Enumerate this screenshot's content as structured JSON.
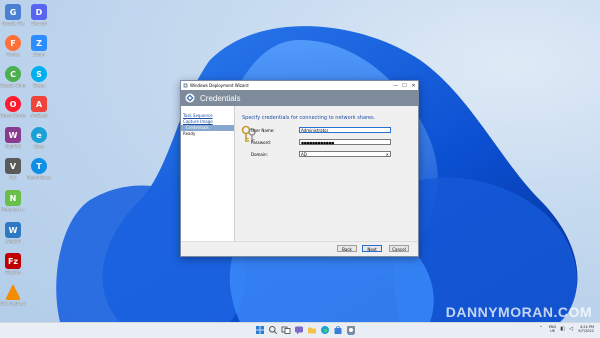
{
  "desktop": {
    "icons": [
      {
        "label": "Google File",
        "icon": "google-file-icon",
        "color": "#4a7fd4"
      },
      {
        "label": "Discord",
        "icon": "discord-icon",
        "color": "#5865f2"
      },
      {
        "label": "Firefox",
        "icon": "firefox-icon",
        "color": "#ff7139"
      },
      {
        "label": "Zoom",
        "icon": "zoom-icon",
        "color": "#2d8cff"
      },
      {
        "label": "Google Chrome",
        "icon": "chrome-icon",
        "color": "#4caf50"
      },
      {
        "label": "Skype",
        "icon": "skype-icon",
        "color": "#00aff0"
      },
      {
        "label": "Opera Browser",
        "icon": "opera-icon",
        "color": "#ff1b2d"
      },
      {
        "label": "AnyDesk",
        "icon": "anydesk-icon",
        "color": "#ef443b"
      },
      {
        "label": "WinRAR",
        "icon": "winrar-icon",
        "color": "#8a3a8f"
      },
      {
        "label": "Edge",
        "icon": "edge-icon",
        "color": "#1ba0d7"
      },
      {
        "label": "VLC",
        "icon": "vlc-icon",
        "color": "#5a5a5a"
      },
      {
        "label": "TeamViewer",
        "icon": "teamviewer-icon",
        "color": "#0e8ee9"
      },
      {
        "label": "Notepad++",
        "icon": "notepadpp-icon",
        "color": "#6abf4b"
      },
      {
        "label": "WinSCP",
        "icon": "winscp-icon",
        "color": "#2f78c4"
      },
      {
        "label": "FileZilla",
        "icon": "filezilla-icon",
        "color": "#bf0000"
      },
      {
        "label": "VLC media player",
        "icon": "vlc-media-player-icon",
        "color": "#f48b00"
      }
    ],
    "watermark": "DANNYMORAN.COM"
  },
  "window": {
    "title": "Windows Deployment Wizard",
    "banner_title": "Credentials",
    "nav_items": [
      {
        "label": "Task Sequence",
        "state": "link"
      },
      {
        "label": "Capture Image",
        "state": "link"
      },
      {
        "label": "Credentials",
        "state": "active"
      },
      {
        "label": "Ready",
        "state": "normal"
      }
    ],
    "heading": "Specify credentials for connecting to network shares.",
    "fields": {
      "user_name": {
        "label": "User Name:",
        "value": "Administrator"
      },
      "password": {
        "label": "Password:",
        "value": "●●●●●●●●●●●●"
      },
      "domain": {
        "label": "Domain:",
        "value": "AD",
        "clear": "✕"
      }
    },
    "buttons": {
      "back": "Back",
      "next": "Next",
      "cancel": "Cancel"
    },
    "accent": "#1f4ea8"
  },
  "taskbar": {
    "apps": [
      {
        "icon": "start-icon",
        "color": "#2a7fd4"
      },
      {
        "icon": "search-icon",
        "color": "#9aa3ad"
      },
      {
        "icon": "task-view-icon",
        "color": "#6c7580"
      },
      {
        "icon": "chat-icon",
        "color": "#7b68c9"
      },
      {
        "icon": "file-explorer-icon",
        "color": "#f2c14e"
      },
      {
        "icon": "edge-icon",
        "color": "#1ba0d7"
      },
      {
        "icon": "store-icon",
        "color": "#3b7dd8"
      },
      {
        "icon": "deployment-wizard-icon",
        "color": "#7d8b9a"
      }
    ],
    "lang_top": "ENG",
    "lang_bottom": "UK",
    "time": "4:24 PM",
    "date": "9/7/2022"
  }
}
